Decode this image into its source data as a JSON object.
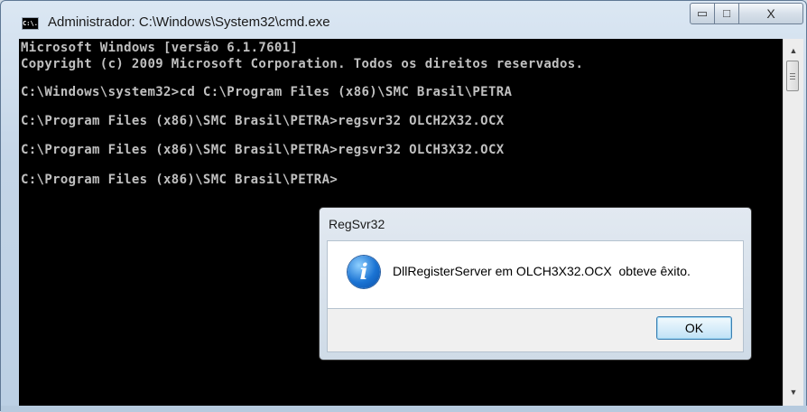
{
  "window": {
    "title": "Administrador: C:\\Windows\\System32\\cmd.exe",
    "icon_label": "C:\\.",
    "minimize_symbol": "▭",
    "maximize_symbol": "□",
    "close_symbol": "X"
  },
  "console": {
    "lines": [
      "Microsoft Windows [versão 6.1.7601]",
      "Copyright (c) 2009 Microsoft Corporation. Todos os direitos reservados.",
      "C:\\Windows\\system32>cd C:\\Program Files (x86)\\SMC Brasil\\PETRA",
      "C:\\Program Files (x86)\\SMC Brasil\\PETRA>regsvr32 OLCH2X32.OCX",
      "C:\\Program Files (x86)\\SMC Brasil\\PETRA>regsvr32 OLCH3X32.OCX",
      "C:\\Program Files (x86)\\SMC Brasil\\PETRA>"
    ],
    "colors": {
      "background": "#000000",
      "text": "#c0c0c0"
    }
  },
  "scrollbar": {
    "up_symbol": "▲",
    "down_symbol": "▼"
  },
  "dialog": {
    "title": "RegSvr32",
    "icon": "info-icon",
    "icon_glyph": "i",
    "message": "DllRegisterServer em OLCH3X32.OCX  obteve êxito.",
    "ok_label": "OK"
  }
}
